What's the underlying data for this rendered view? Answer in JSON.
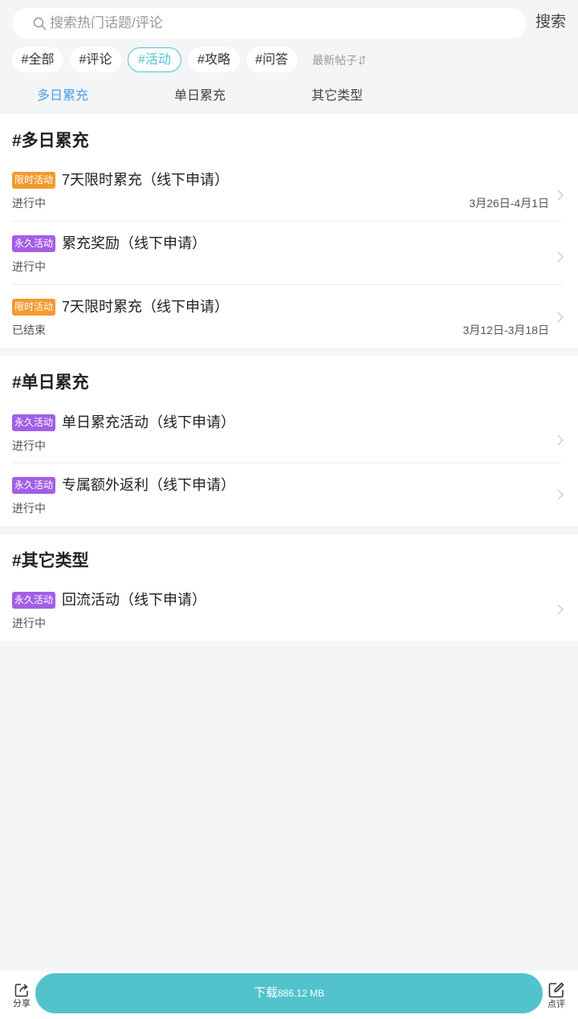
{
  "search": {
    "placeholder": "搜索热门话题/评论",
    "button_label": "搜索"
  },
  "tags": [
    "#全部",
    "#评论",
    "#活动",
    "#攻略",
    "#问答"
  ],
  "active_tag": "#活动",
  "sort": {
    "label": "最新帖子",
    "icon": "sort-icon"
  },
  "subtabs": [
    "多日累充",
    "单日累充",
    "其它类型"
  ],
  "active_subtab": "多日累充",
  "sections": [
    {
      "title": "#多日累充",
      "items": [
        {
          "badge": "限时活动",
          "title": "7天限时累充（线下申请）",
          "status": "进行中",
          "date": "3月26日-4月1日"
        },
        {
          "badge": "永久活动",
          "title": "累充奖励（线下申请）",
          "status": "进行中",
          "date": ""
        },
        {
          "badge": "限时活动",
          "title": "7天限时累充（线下申请）",
          "status": "已结束",
          "date": "3月12日-3月18日"
        }
      ]
    },
    {
      "title": "#单日累充",
      "items": [
        {
          "badge": "永久活动",
          "title": "单日累充活动（线下申请）",
          "status": "进行中",
          "date": ""
        },
        {
          "badge": "永久活动",
          "title": "专属额外返利（线下申请）",
          "status": "进行中",
          "date": ""
        }
      ]
    },
    {
      "title": "#其它类型",
      "items": [
        {
          "badge": "永久活动",
          "title": "回流活动（线下申请）",
          "status": "进行中",
          "date": ""
        }
      ]
    }
  ],
  "bottom_bar": {
    "share_label": "分享",
    "download_label": "下载",
    "download_size": "886.12 MB",
    "review_label": "点评"
  },
  "colors": {
    "accent": "#52c3cc",
    "subtab_active": "#4a9fe6",
    "badge_limited": "#f29a2f",
    "badge_permanent": "#a35ee6"
  }
}
